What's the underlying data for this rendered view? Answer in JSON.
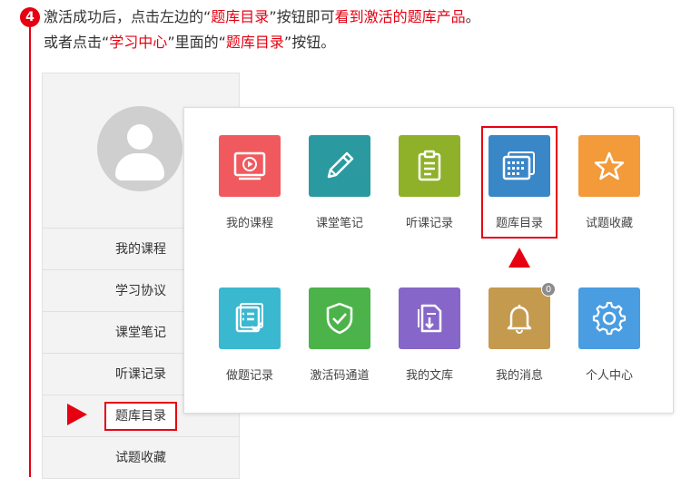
{
  "step": {
    "number": "4"
  },
  "instructions": {
    "line1_a": "激活成功后，点击左边的“",
    "line1_b": "题库目录",
    "line1_c": "”按钮即可",
    "line1_d": "看到激活的题库产品",
    "line1_e": "。",
    "line2_a": "或者点击“",
    "line2_b": "学习中心",
    "line2_c": "”里面的“",
    "line2_d": "题库目录",
    "line2_e": "”按钮。"
  },
  "sidebar": {
    "items": [
      {
        "label": "我的课程"
      },
      {
        "label": "学习协议"
      },
      {
        "label": "课堂笔记"
      },
      {
        "label": "听课记录"
      },
      {
        "label": "题库目录"
      },
      {
        "label": "试题收藏"
      }
    ]
  },
  "grid": {
    "tiles": [
      {
        "label": "我的课程",
        "color": "#f05a5f",
        "icon": "video-icon"
      },
      {
        "label": "课堂笔记",
        "color": "#2a9aa0",
        "icon": "pencil-icon"
      },
      {
        "label": "听课记录",
        "color": "#8fb12a",
        "icon": "clipboard-icon"
      },
      {
        "label": "题库目录",
        "color": "#3a87c8",
        "icon": "question-bank-icon"
      },
      {
        "label": "试题收藏",
        "color": "#f39a3b",
        "icon": "star-icon"
      },
      {
        "label": "做题记录",
        "color": "#3ab8d0",
        "icon": "record-icon"
      },
      {
        "label": "激活码通道",
        "color": "#4cb34a",
        "icon": "shield-check-icon"
      },
      {
        "label": "我的文库",
        "color": "#8766c9",
        "icon": "document-icon"
      },
      {
        "label": "我的消息",
        "color": "#c49a4e",
        "icon": "bell-icon",
        "badge": "0"
      },
      {
        "label": "个人中心",
        "color": "#4a9de0",
        "icon": "gear-icon"
      }
    ]
  },
  "colors": {
    "accent": "#e60012"
  }
}
